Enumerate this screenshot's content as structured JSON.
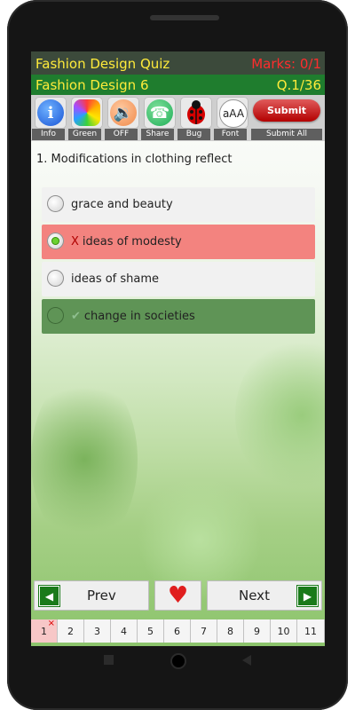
{
  "header": {
    "title": "Fashion Design Quiz",
    "marks": "Marks: 0/1",
    "subtitle": "Fashion Design 6",
    "question_number": "Q.1/36"
  },
  "toolbar": {
    "buttons": [
      {
        "label": "Info",
        "icon": "info-icon"
      },
      {
        "label": "Green",
        "icon": "color-palette-icon"
      },
      {
        "label": "OFF",
        "icon": "speaker-icon"
      },
      {
        "label": "Share",
        "icon": "whatsapp-icon"
      },
      {
        "label": "Bug",
        "icon": "ladybug-icon"
      },
      {
        "label": "Font",
        "icon": "font-size-icon"
      },
      {
        "label": "Submit All",
        "icon": "submit-button",
        "button_text": "Submit"
      }
    ]
  },
  "question": {
    "text": "1. Modifications in clothing reflect",
    "options": [
      {
        "text": "grace and beauty",
        "state": "neutral"
      },
      {
        "text": "ideas of modesty",
        "state": "wrong",
        "mark": "X"
      },
      {
        "text": "ideas of shame",
        "state": "neutral"
      },
      {
        "text": "change in societies",
        "state": "correct",
        "mark": "✔"
      }
    ]
  },
  "navigation": {
    "prev_label": "Prev",
    "next_label": "Next"
  },
  "pagination": {
    "pages": [
      "1",
      "2",
      "3",
      "4",
      "5",
      "6",
      "7",
      "8",
      "9",
      "10",
      "11"
    ],
    "active": "1",
    "active_mark": "×"
  },
  "colors": {
    "header_top": "#3c4a3b",
    "header_bottom": "#1f7d2e",
    "title_yellow": "#ffeb3b",
    "marks_red": "#ff2d2d",
    "wrong_option": "#f3837f",
    "correct_option": "#5f9456"
  }
}
